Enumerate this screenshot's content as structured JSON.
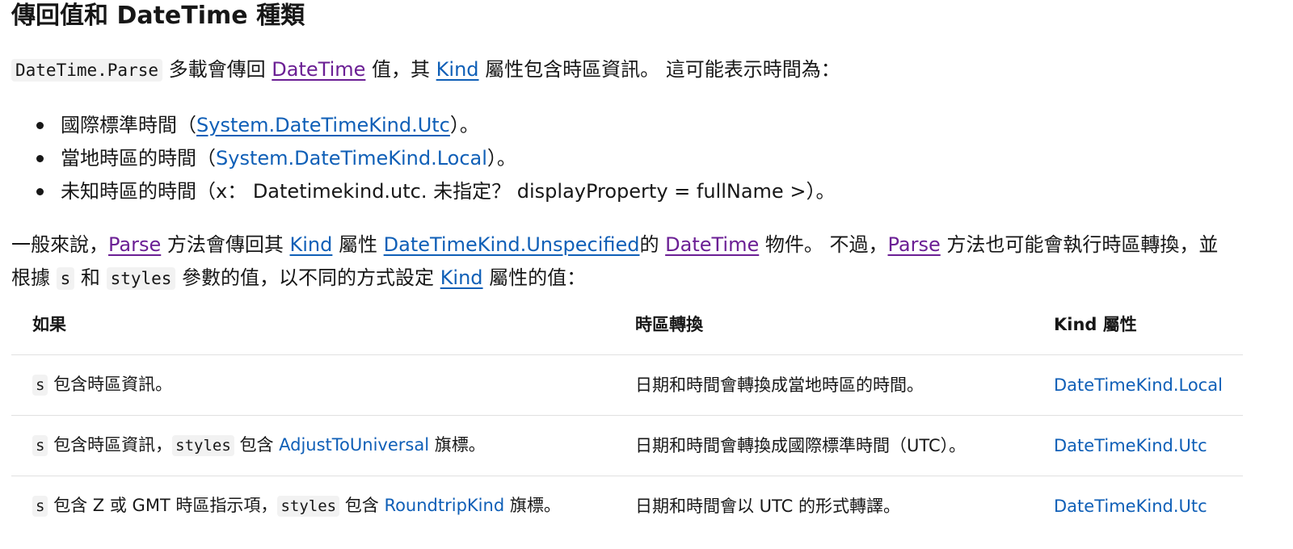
{
  "heading": "傳回值和 DateTime 種類",
  "intro": {
    "code": "DateTime.Parse",
    "t1": " 多載會傳回 ",
    "link1": "DateTime",
    "t2": " 值，其 ",
    "link2": "Kind",
    "t3": " 屬性包含時區資訊。 這可能表示時間為："
  },
  "bullets": [
    {
      "pre": "國際標準時間（",
      "link": "System.DateTimeKind.Utc",
      "post": "）。"
    },
    {
      "pre": "當地時區的時間（",
      "link": "System.DateTimeKind.Local",
      "post": "）。"
    },
    {
      "text": "未知時區的時間（x： Datetimekind.utc. 未指定？ displayProperty = fullName >）。"
    }
  ],
  "paragraph2": {
    "t1": "一般來說，",
    "link_parse": "Parse",
    "t2": " 方法會傳回其 ",
    "link_kind": "Kind",
    "t3": " 屬性 ",
    "link_unspecified": "DateTimeKind.Unspecified",
    "t4": "的 ",
    "link_datetime": "DateTime",
    "t5": " 物件。 不過，",
    "link_parse2": "Parse",
    "t6": " 方法也可能會執行時區轉換，並",
    "t7": "根據 ",
    "code_s": "s",
    "t8": " 和 ",
    "code_styles": "styles",
    "t9": " 參數的值，以不同的方式設定 ",
    "link_kind2": "Kind",
    "t10": " 屬性的值："
  },
  "table": {
    "headers": [
      "如果",
      "時區轉換",
      "Kind 屬性"
    ],
    "rows": [
      {
        "cond_code": "s",
        "cond_text": " 包含時區資訊。",
        "conversion": "日期和時間會轉換成當地時區的時間。",
        "kind": "DateTimeKind.Local"
      },
      {
        "cond_code": "s",
        "cond_text": " 包含時區資訊，",
        "cond_code2": "styles",
        "cond_text2": " 包含 ",
        "cond_link": "AdjustToUniversal",
        "cond_text3": " 旗標。",
        "conversion": "日期和時間會轉換成國際標準時間（UTC）。",
        "kind": "DateTimeKind.Utc"
      },
      {
        "cond_code": "s",
        "cond_text": " 包含 Z 或 GMT 時區指示項，",
        "cond_code2": "styles",
        "cond_text2": " 包含 ",
        "cond_link": "RoundtripKind",
        "cond_text3": " 旗標。",
        "conversion": "日期和時間會以 UTC 的形式轉譯。",
        "kind": "DateTimeKind.Utc"
      }
    ]
  }
}
